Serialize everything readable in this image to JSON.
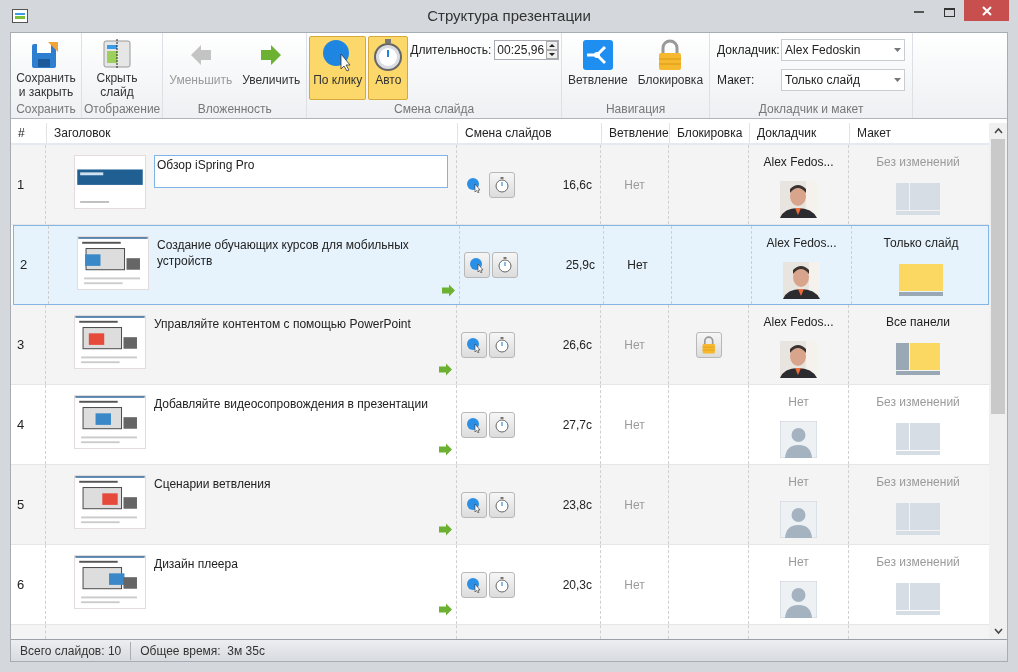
{
  "window": {
    "title": "Структура презентации"
  },
  "ribbon": {
    "groups": [
      {
        "label": "Сохранить",
        "buttons": [
          {
            "label": "Сохранить и закрыть",
            "kind": "save",
            "disabled": false,
            "selected": false
          }
        ]
      },
      {
        "label": "Отображение",
        "buttons": [
          {
            "label": "Скрыть слайд",
            "kind": "hide",
            "disabled": false,
            "selected": false
          }
        ]
      },
      {
        "label": "Вложенность",
        "buttons": [
          {
            "label": "Уменьшить",
            "kind": "left",
            "disabled": true,
            "selected": false
          },
          {
            "label": "Увеличить",
            "kind": "right",
            "disabled": false,
            "selected": false
          }
        ]
      },
      {
        "label": "Смена слайда",
        "buttons": [
          {
            "label": "По клику",
            "kind": "click",
            "disabled": false,
            "selected": true
          },
          {
            "label": "Авто",
            "kind": "timer",
            "disabled": false,
            "selected": true
          }
        ],
        "duration": {
          "label": "Длительность:",
          "value": "00:25,96"
        }
      },
      {
        "label": "Навигация",
        "buttons": [
          {
            "label": "Ветвление",
            "kind": "branch",
            "disabled": false,
            "selected": false
          },
          {
            "label": "Блокировка",
            "kind": "lock",
            "disabled": false,
            "selected": false
          }
        ]
      },
      {
        "label": "Докладчик и макет",
        "fields": [
          {
            "label": "Докладчик:",
            "value": "Alex Fedoskin"
          },
          {
            "label": "Макет:",
            "value": "Только слайд"
          }
        ]
      }
    ]
  },
  "table": {
    "columns": [
      "#",
      "Заголовок",
      "Смена слайдов",
      "Ветвление",
      "Блокировка",
      "Докладчик",
      "Макет"
    ],
    "rows": [
      {
        "num": "1",
        "title": "Обзор iSpring Pro",
        "editing": true,
        "selected": false,
        "click_framed": false,
        "time": "16,6с",
        "branch": "Нет",
        "branch_set": false,
        "locked": false,
        "presenter": "Alex Fedos...",
        "has_photo": true,
        "layout": {
          "label": "Без изменений",
          "kind": "none"
        },
        "nested": false
      },
      {
        "num": "2",
        "title": "Создание обучающих курсов для мобильных устройств",
        "editing": false,
        "selected": true,
        "click_framed": true,
        "time": "25,9с",
        "branch": "Нет",
        "branch_set": true,
        "locked": false,
        "presenter": "Alex Fedos...",
        "has_photo": true,
        "layout": {
          "label": "Только слайд",
          "kind": "slide"
        },
        "nested": true
      },
      {
        "num": "3",
        "title": "Управляйте контентом с помощью PowerPoint",
        "editing": false,
        "selected": false,
        "click_framed": true,
        "time": "26,6с",
        "branch": "Нет",
        "branch_set": false,
        "locked": true,
        "presenter": "Alex Fedos...",
        "has_photo": true,
        "layout": {
          "label": "Все панели",
          "kind": "panels"
        },
        "nested": true
      },
      {
        "num": "4",
        "title": "Добавляйте видеосопровождения в презентации",
        "editing": false,
        "selected": false,
        "click_framed": true,
        "time": "27,7с",
        "branch": "Нет",
        "branch_set": false,
        "locked": false,
        "presenter": "Нет",
        "has_photo": false,
        "layout": {
          "label": "Без изменений",
          "kind": "none"
        },
        "nested": true
      },
      {
        "num": "5",
        "title": "Сценарии ветвления",
        "editing": false,
        "selected": false,
        "click_framed": true,
        "time": "23,8с",
        "branch": "Нет",
        "branch_set": false,
        "locked": false,
        "presenter": "Нет",
        "has_photo": false,
        "layout": {
          "label": "Без изменений",
          "kind": "none"
        },
        "nested": true
      },
      {
        "num": "6",
        "title": "Дизайн плеера",
        "editing": false,
        "selected": false,
        "click_framed": true,
        "time": "20,3с",
        "branch": "Нет",
        "branch_set": false,
        "locked": false,
        "presenter": "Нет",
        "has_photo": false,
        "layout": {
          "label": "Без изменений",
          "kind": "none"
        },
        "nested": true
      }
    ]
  },
  "status_bar": [
    "Всего слайдов: 10",
    "Общее время:  3м 35с"
  ]
}
